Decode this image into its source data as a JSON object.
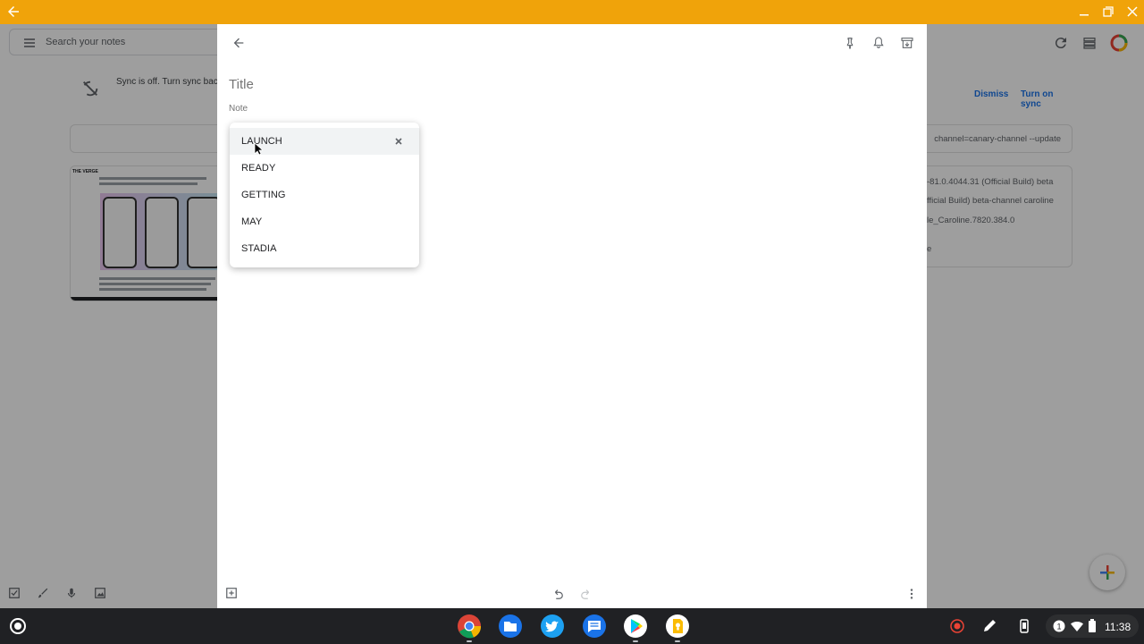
{
  "window": {
    "titlebar_color": "#f0a30a"
  },
  "background": {
    "search_placeholder": "Search your notes",
    "sync_message": "Sync is off. Turn sync back o",
    "dismiss_label": "Dismiss",
    "turn_on_sync_label": "Turn on sync",
    "note_partial_text": "channel=canary-channel --update",
    "card_left_header": "THE VERGE",
    "card_lines": [
      "-81.0.4044.31 (Official Build) beta",
      "fficial Build) beta-channel caroline",
      "le_Caroline.7820.384.0",
      "e"
    ]
  },
  "editor": {
    "title_placeholder": "Title",
    "note_placeholder": "Note"
  },
  "suggestions": [
    {
      "label": "LAUNCH",
      "highlighted": true
    },
    {
      "label": "READY",
      "highlighted": false
    },
    {
      "label": "GETTING",
      "highlighted": false
    },
    {
      "label": "MAY",
      "highlighted": false
    },
    {
      "label": "STADIA",
      "highlighted": false
    }
  ],
  "shelf": {
    "apps": [
      "chrome-icon",
      "files-icon",
      "twitter-icon",
      "messages-icon",
      "play-store-icon",
      "keep-icon"
    ],
    "notification_count": "1",
    "time": "11:38"
  },
  "colors": {
    "accent_blue": "#1a73e8",
    "keep_yellow": "#fbbc04"
  }
}
